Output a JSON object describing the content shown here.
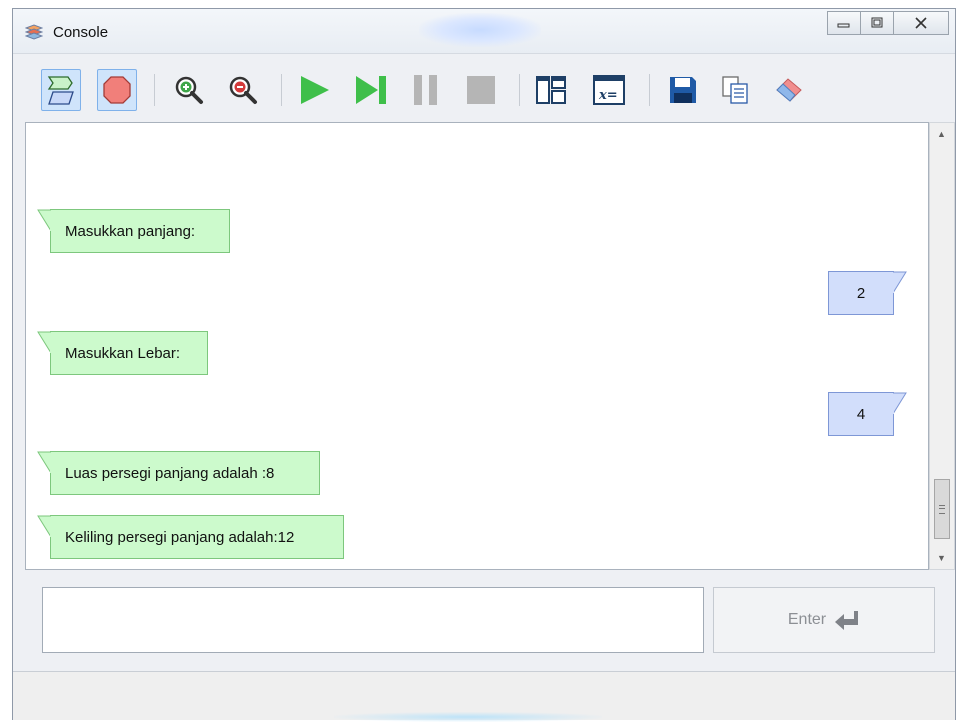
{
  "window": {
    "title": "Console",
    "controls": [
      "minimize",
      "maximize",
      "close"
    ]
  },
  "toolbar": {
    "buttons": [
      {
        "icon": "flowchart-view-icon",
        "active": true
      },
      {
        "icon": "stop-sign-icon",
        "active": true
      },
      {
        "icon": "zoom-in-icon"
      },
      {
        "icon": "zoom-out-icon"
      },
      {
        "icon": "run-icon"
      },
      {
        "icon": "step-icon"
      },
      {
        "icon": "pause-icon"
      },
      {
        "icon": "stop-icon"
      },
      {
        "icon": "layout-panels-icon"
      },
      {
        "icon": "variable-watch-icon"
      },
      {
        "icon": "save-icon"
      },
      {
        "icon": "copy-icon"
      },
      {
        "icon": "eraser-icon"
      }
    ]
  },
  "console": {
    "messages": [
      {
        "type": "output",
        "text": "Masukkan panjang:"
      },
      {
        "type": "input",
        "text": "2"
      },
      {
        "type": "output",
        "text": "Masukkan Lebar:"
      },
      {
        "type": "input",
        "text": "4"
      },
      {
        "type": "output",
        "text": "Luas persegi panjang adalah :8"
      },
      {
        "type": "output",
        "text": "Keliling persegi panjang adalah:12"
      }
    ]
  },
  "input": {
    "value": "",
    "enter_label": "Enter"
  },
  "colors": {
    "output_bubble": "#ccfacc",
    "input_bubble": "#d2defb",
    "toolbar_active": "#cfe4fb"
  }
}
